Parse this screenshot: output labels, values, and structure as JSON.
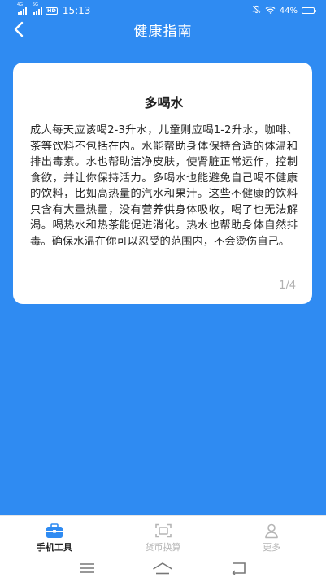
{
  "status_bar": {
    "net1": "4G",
    "net2": "5G",
    "hd": "HD",
    "time": "15:13",
    "battery_text": "44%",
    "battery_level": 0.44
  },
  "nav": {
    "title": "健康指南"
  },
  "card": {
    "title": "多喝水",
    "body": "成人每天应该喝2-3升水，儿童则应喝1-2升水，咖啡、茶等饮料不包括在内。水能帮助身体保持合适的体温和排出毒素。水也帮助洁净皮肤，使肾脏正常运作，控制食欲，并让你保持活力。多喝水也能避免自己喝不健康的饮料，比如高热量的汽水和果汁。这些不健康的饮料只含有大量热量，没有营养供身体吸收，喝了也无法解渴。喝热水和热茶能促进消化。热水也帮助身体自然排毒。确保水温在你可以忍受的范围内，不会烫伤自己。",
    "pager": "1/4"
  },
  "tabs": [
    {
      "label": "手机工具",
      "icon": "toolbox-icon",
      "active": true
    },
    {
      "label": "货币换算",
      "icon": "scan-icon",
      "active": false
    },
    {
      "label": "更多",
      "icon": "person-icon",
      "active": false
    }
  ],
  "colors": {
    "background": "#2F8BF2",
    "accent": "#2F8BF2",
    "inactive": "#b5b5b5"
  }
}
